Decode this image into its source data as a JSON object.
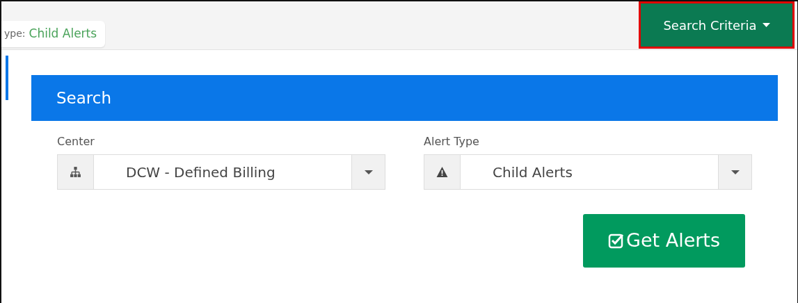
{
  "filter_chip": {
    "label": "ype:",
    "value": "Child Alerts"
  },
  "search_criteria_button": {
    "label": "Search Criteria",
    "highlighted": true
  },
  "panel": {
    "title": "Search",
    "fields": [
      {
        "label": "Center",
        "value": "DCW - Defined Billing"
      },
      {
        "label": "Alert Type",
        "value": "Child Alerts"
      }
    ],
    "submit_button": {
      "label": "Get Alerts"
    }
  }
}
